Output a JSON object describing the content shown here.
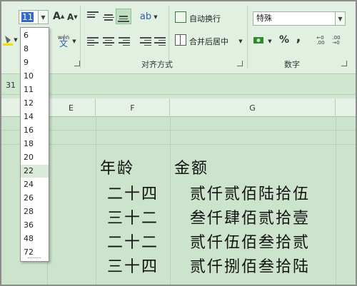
{
  "toolbar": {
    "font_size_value": "11",
    "number_format_value": "特殊",
    "wrap_text_label": "自动换行",
    "merge_center_label": "合并后居中",
    "percent_label": "%",
    "comma_label": ",",
    "pinyin_label": "wén",
    "alignment_group_label": "对齐方式",
    "number_group_label": "数字"
  },
  "formula_bar": {
    "name_box_value": "31"
  },
  "font_size_dropdown": {
    "items": [
      "6",
      "8",
      "9",
      "10",
      "11",
      "12",
      "14",
      "16",
      "18",
      "20",
      "22",
      "24",
      "26",
      "28",
      "36",
      "48",
      "72"
    ],
    "highlighted": "22"
  },
  "columns": [
    "E",
    "F",
    "G"
  ],
  "cells": {
    "header_age": "年龄",
    "header_amount": "金额",
    "rows": [
      {
        "age": "二十四",
        "amount": "贰仟贰佰陆拾伍"
      },
      {
        "age": "三十二",
        "amount": "叁仟肆佰贰拾壹"
      },
      {
        "age": "二十二",
        "amount": "贰仟伍佰叁拾贰"
      },
      {
        "age": "三十四",
        "amount": "贰仟捌佰叁拾陆"
      }
    ]
  },
  "colors": {
    "ribbon_bg": "#e1f0e1",
    "sheet_bg": "#cce4cc",
    "highlight": "#d8ebd8",
    "selection_blue": "#2f69c9"
  }
}
